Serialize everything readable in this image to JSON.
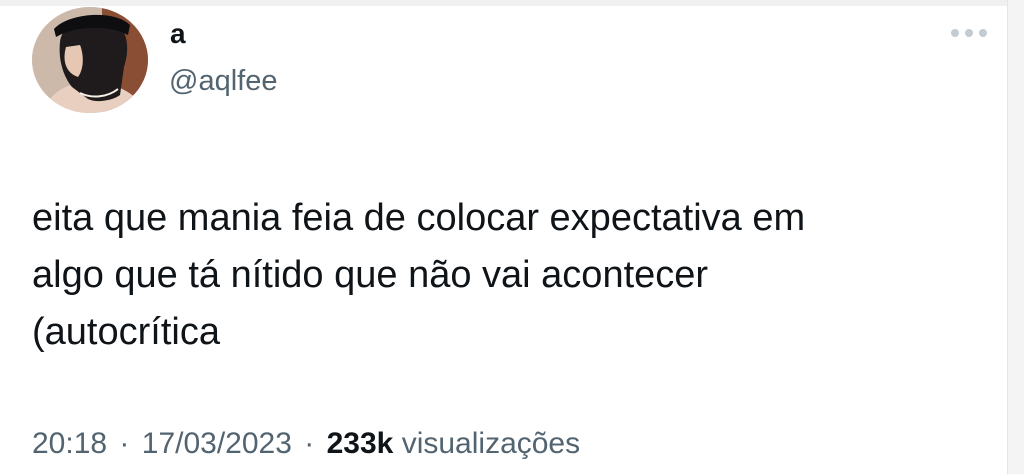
{
  "tweet": {
    "author": {
      "display_name": "a",
      "handle": "@aqlfee"
    },
    "text": "eita que mania feia de colocar expectativa em\nalgo que tá nítido que não vai acontecer\n(autocrítica",
    "time": "20:18",
    "separator": "·",
    "date": "17/03/2023",
    "views_count": "233k",
    "views_label": "visualizações"
  },
  "icons": {
    "more": "more-horizontal-icon"
  },
  "colors": {
    "text_primary": "#0f1419",
    "text_secondary": "#536471",
    "background": "#ffffff"
  }
}
